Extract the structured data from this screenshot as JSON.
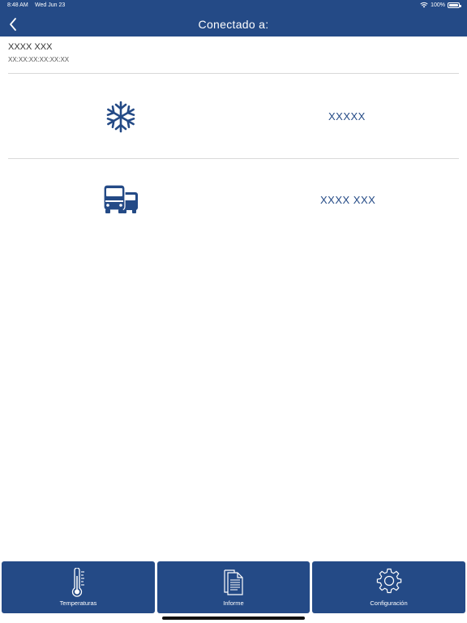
{
  "status_bar": {
    "time": "8:48 AM",
    "date": "Wed Jun 23",
    "battery": "100%"
  },
  "nav": {
    "title": "Conectado a:",
    "back_icon": "chevron-left-icon"
  },
  "device": {
    "name": "XXXX XXX",
    "mac": "XX:XX:XX:XX:XX:XX"
  },
  "rows": [
    {
      "icon": "snowflake-icon",
      "value": "XXXXX"
    },
    {
      "icon": "trucks-icon",
      "value": "XXXX XXX"
    }
  ],
  "tabs": [
    {
      "label": "Temperaturas",
      "icon": "thermometer-icon"
    },
    {
      "label": "Informe",
      "icon": "document-icon"
    },
    {
      "label": "Configuración",
      "icon": "gear-icon"
    }
  ],
  "colors": {
    "primary": "#244a86",
    "background": "#ffffff",
    "divider": "#d9d9d9"
  }
}
